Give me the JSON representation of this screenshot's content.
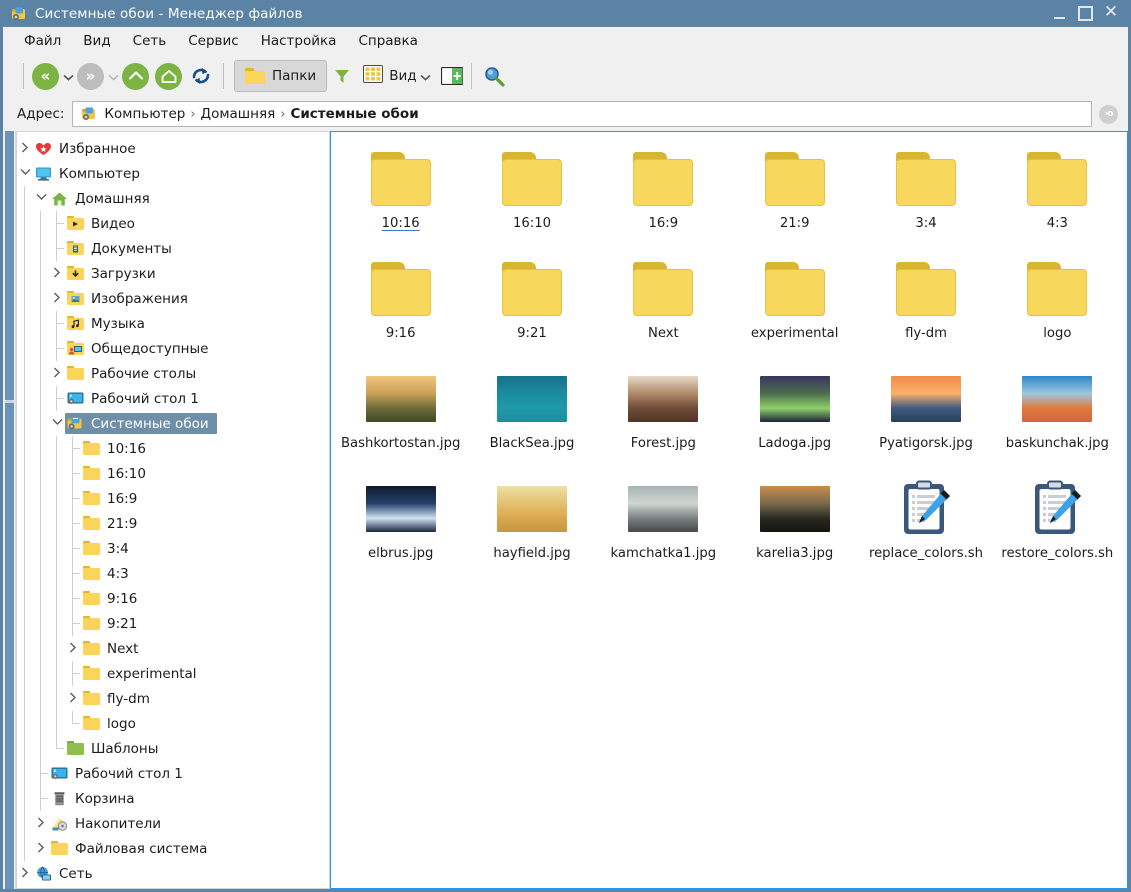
{
  "window": {
    "title": "Системные обои - Менеджер файлов",
    "title_icon": "file-manager-icon",
    "minimize_label": "",
    "maximize_label": "",
    "close_label": "✕",
    "titlebar_color": "#5b83a5"
  },
  "menubar": {
    "items": [
      {
        "label": "Файл"
      },
      {
        "label": "Вид"
      },
      {
        "label": "Сеть"
      },
      {
        "label": "Сервис"
      },
      {
        "label": "Настройка"
      },
      {
        "label": "Справка"
      }
    ]
  },
  "toolbar": {
    "back_label": "«",
    "back_icon": "back-icon",
    "back_enabled": true,
    "back_dropdown_icon": "chevron-down-icon",
    "forward_label": "»",
    "forward_icon": "forward-icon",
    "forward_enabled": false,
    "forward_dropdown_icon": "chevron-down-icon",
    "up_icon": "arrow-up-icon",
    "home_icon": "home-icon",
    "refresh_icon": "refresh-icon",
    "folders_label": "Папки",
    "folders_icon": "folder-icon",
    "filter_icon": "filter-funnel-icon",
    "view_label": "Вид",
    "view_icon": "grid-view-icon",
    "view_dropdown_icon": "chevron-down-icon",
    "split_icon": "split-view-add-icon",
    "search_icon": "search-icon",
    "accent_green": "#7cb342",
    "accent_blue": "#2196f3"
  },
  "address": {
    "label": "Адрес:",
    "path_icon": "file-manager-icon",
    "crumbs": [
      "Компьютер",
      "Домашняя",
      "Системные обои"
    ],
    "separator": "›",
    "go_label": "›o",
    "go_icon": "go-icon"
  },
  "sidebar": {
    "items": [
      {
        "label": "Избранное",
        "depth": 0,
        "twist": "collapsed",
        "icon": "heart-icon"
      },
      {
        "label": "Компьютер",
        "depth": 0,
        "twist": "expanded",
        "icon": "computer-icon"
      },
      {
        "label": "Домашняя",
        "depth": 1,
        "twist": "expanded",
        "icon": "home-icon"
      },
      {
        "label": "Видео",
        "depth": 2,
        "twist": "none",
        "icon": "folder-video-icon"
      },
      {
        "label": "Документы",
        "depth": 2,
        "twist": "none",
        "icon": "folder-documents-icon"
      },
      {
        "label": "Загрузки",
        "depth": 2,
        "twist": "collapsed",
        "icon": "folder-downloads-icon"
      },
      {
        "label": "Изображения",
        "depth": 2,
        "twist": "collapsed",
        "icon": "folder-pictures-icon"
      },
      {
        "label": "Музыка",
        "depth": 2,
        "twist": "none",
        "icon": "folder-music-icon"
      },
      {
        "label": "Общедоступные",
        "depth": 2,
        "twist": "none",
        "icon": "folder-public-icon"
      },
      {
        "label": "Рабочие столы",
        "depth": 2,
        "twist": "collapsed",
        "icon": "folder-icon"
      },
      {
        "label": "Рабочий стол 1",
        "depth": 2,
        "twist": "none",
        "icon": "desktop-icon"
      },
      {
        "label": "Системные обои",
        "depth": 2,
        "twist": "expanded",
        "icon": "file-manager-icon",
        "selected": true
      },
      {
        "label": "10:16",
        "depth": 3,
        "twist": "none",
        "icon": "folder-icon"
      },
      {
        "label": "16:10",
        "depth": 3,
        "twist": "none",
        "icon": "folder-icon"
      },
      {
        "label": "16:9",
        "depth": 3,
        "twist": "none",
        "icon": "folder-icon"
      },
      {
        "label": "21:9",
        "depth": 3,
        "twist": "none",
        "icon": "folder-icon"
      },
      {
        "label": "3:4",
        "depth": 3,
        "twist": "none",
        "icon": "folder-icon"
      },
      {
        "label": "4:3",
        "depth": 3,
        "twist": "none",
        "icon": "folder-icon"
      },
      {
        "label": "9:16",
        "depth": 3,
        "twist": "none",
        "icon": "folder-icon"
      },
      {
        "label": "9:21",
        "depth": 3,
        "twist": "none",
        "icon": "folder-icon"
      },
      {
        "label": "Next",
        "depth": 3,
        "twist": "collapsed",
        "icon": "folder-icon"
      },
      {
        "label": "experimental",
        "depth": 3,
        "twist": "none",
        "icon": "folder-icon"
      },
      {
        "label": "fly-dm",
        "depth": 3,
        "twist": "collapsed",
        "icon": "folder-icon"
      },
      {
        "label": "logo",
        "depth": 3,
        "twist": "none",
        "icon": "folder-icon",
        "last": true
      },
      {
        "label": "Шаблоны",
        "depth": 2,
        "twist": "none",
        "icon": "folder-templates-icon",
        "last": true
      },
      {
        "label": "Рабочий стол 1",
        "depth": 1,
        "twist": "none",
        "icon": "desktop-icon"
      },
      {
        "label": "Корзина",
        "depth": 1,
        "twist": "none",
        "icon": "trash-icon"
      },
      {
        "label": "Накопители",
        "depth": 1,
        "twist": "collapsed",
        "icon": "drives-icon"
      },
      {
        "label": "Файловая система",
        "depth": 1,
        "twist": "collapsed",
        "icon": "folder-icon",
        "last": true
      },
      {
        "label": "Сеть",
        "depth": 0,
        "twist": "collapsed",
        "icon": "network-icon"
      }
    ],
    "selection_color": "#6f8fa8"
  },
  "content": {
    "items": [
      {
        "name": "10:16",
        "type": "folder",
        "hovered": true
      },
      {
        "name": "16:10",
        "type": "folder"
      },
      {
        "name": "16:9",
        "type": "folder"
      },
      {
        "name": "21:9",
        "type": "folder"
      },
      {
        "name": "3:4",
        "type": "folder"
      },
      {
        "name": "4:3",
        "type": "folder"
      },
      {
        "name": "9:16",
        "type": "folder"
      },
      {
        "name": "9:21",
        "type": "folder"
      },
      {
        "name": "Next",
        "type": "folder"
      },
      {
        "name": "experimental",
        "type": "folder"
      },
      {
        "name": "fly-dm",
        "type": "folder"
      },
      {
        "name": "logo",
        "type": "folder"
      },
      {
        "name": "Bashkortostan.jpg",
        "type": "image",
        "thumb": "sunrise-meadow"
      },
      {
        "name": "BlackSea.jpg",
        "type": "image",
        "thumb": "teal-sea"
      },
      {
        "name": "Forest.jpg",
        "type": "image",
        "thumb": "brown-forest"
      },
      {
        "name": "Ladoga.jpg",
        "type": "image",
        "thumb": "aurora-lake"
      },
      {
        "name": "Pyatigorsk.jpg",
        "type": "image",
        "thumb": "orange-sunset-mountains"
      },
      {
        "name": "baskunchak.jpg",
        "type": "image",
        "thumb": "blue-orange-salt-lake"
      },
      {
        "name": "elbrus.jpg",
        "type": "image",
        "thumb": "night-snow-peak"
      },
      {
        "name": "hayfield.jpg",
        "type": "image",
        "thumb": "golden-hayfield"
      },
      {
        "name": "kamchatka1.jpg",
        "type": "image",
        "thumb": "grey-volcano-haze"
      },
      {
        "name": "karelia3.jpg",
        "type": "image",
        "thumb": "dark-lake-dusk"
      },
      {
        "name": "replace_colors.sh",
        "type": "script",
        "icon": "script-clipboard-pencil-icon"
      },
      {
        "name": "restore_colors.sh",
        "type": "script",
        "icon": "script-clipboard-pencil-icon"
      }
    ]
  }
}
